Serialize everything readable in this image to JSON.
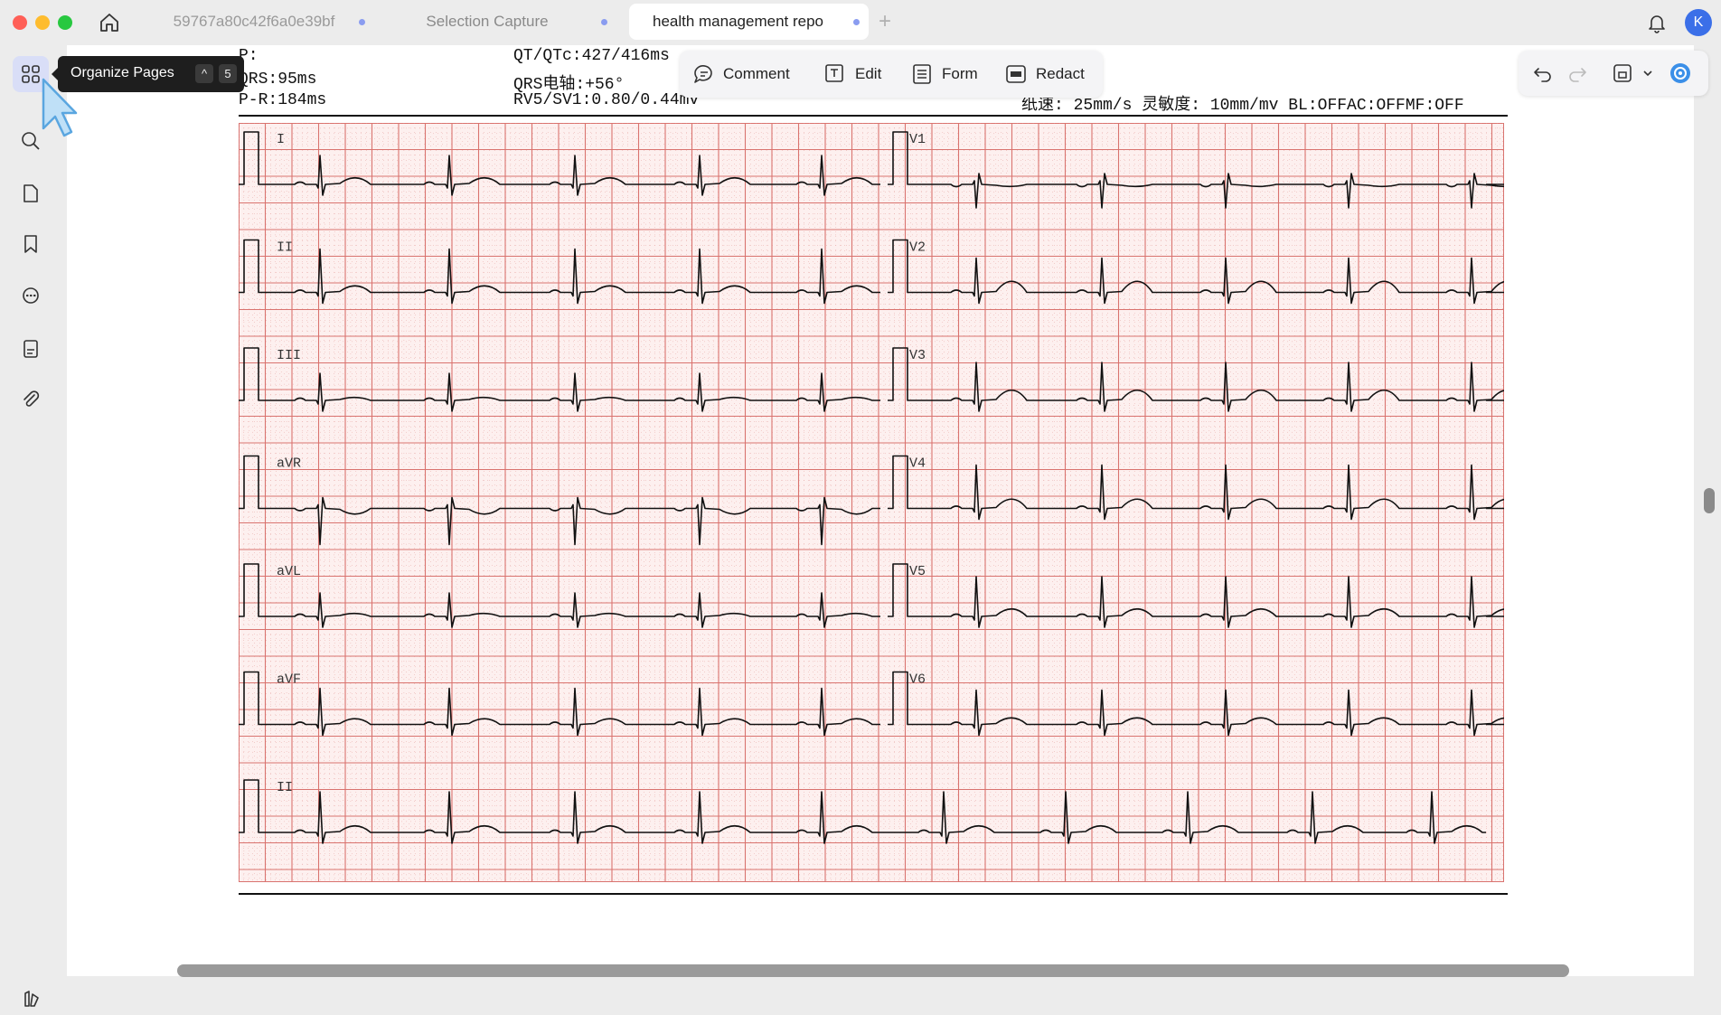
{
  "tabs": [
    {
      "label": "59767a80c42f6a0e39bf",
      "active": false
    },
    {
      "label": "Selection Capture",
      "active": false
    },
    {
      "label": "health management repo",
      "active": true
    }
  ],
  "avatar_initial": "K",
  "tooltip": {
    "label": "Organize Pages",
    "shortcut_mod": "^",
    "shortcut_key": "5"
  },
  "toolbar": {
    "comment_label": "Comment",
    "edit_label": "Edit",
    "form_label": "Form",
    "redact_label": "Redact"
  },
  "ecg_header": {
    "line1_left": "P:",
    "line2_left": "QRS:95ms",
    "line3_left": "P-R:184ms",
    "line1_mid": "QT/QTc:427/416ms",
    "line2_mid": "QRS电轴:+56°",
    "line3_mid": "RV5/SV1:0.80/0.44mv",
    "line3_right": "纸速: 25mm/s 灵敏度: 10mm/mv BL:OFFAC:OFFMF:OFF"
  },
  "leads_left": [
    "I",
    "II",
    "III",
    "aVR",
    "aVL",
    "aVF",
    "II"
  ],
  "leads_right": [
    "V1",
    "V2",
    "V3",
    "V4",
    "V5",
    "V6"
  ],
  "colors": {
    "grid_major": "#d9736f",
    "grid_minor": "#e8a8a6",
    "grid_bg": "#fdf0ef",
    "trace": "#111111",
    "accent": "#3b6fe8"
  }
}
